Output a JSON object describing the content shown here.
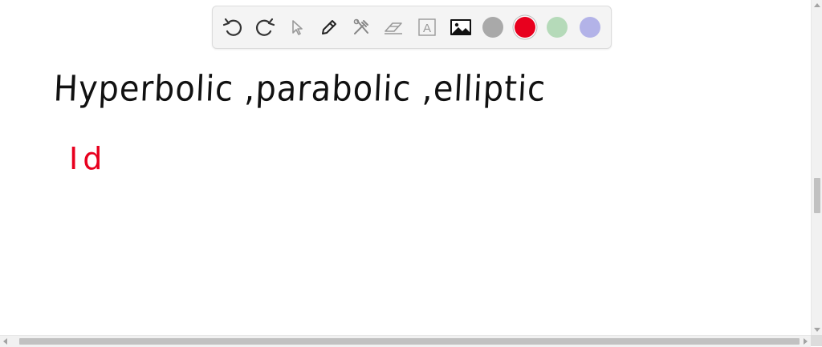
{
  "canvas": {
    "lines": [
      {
        "text": "Hyperbolic ,parabolic ,elliptic",
        "color": "#111111"
      },
      {
        "text": "Id",
        "color": "#e8001e"
      }
    ]
  },
  "toolbar": {
    "tools": [
      {
        "name": "undo",
        "icon": "undo-icon"
      },
      {
        "name": "redo",
        "icon": "redo-icon"
      },
      {
        "name": "select",
        "icon": "pointer-icon"
      },
      {
        "name": "pen",
        "icon": "pencil-icon"
      },
      {
        "name": "tools",
        "icon": "tools-icon"
      },
      {
        "name": "eraser",
        "icon": "eraser-icon"
      },
      {
        "name": "text",
        "icon": "text-box-icon",
        "glyph": "A"
      },
      {
        "name": "image",
        "icon": "image-icon"
      }
    ],
    "colors": [
      {
        "name": "gray",
        "hex": "#a9a9a9"
      },
      {
        "name": "red",
        "hex": "#e8001e",
        "selected": true
      },
      {
        "name": "green",
        "hex": "#b5dab9"
      },
      {
        "name": "lavender",
        "hex": "#b3b3e8"
      }
    ]
  }
}
